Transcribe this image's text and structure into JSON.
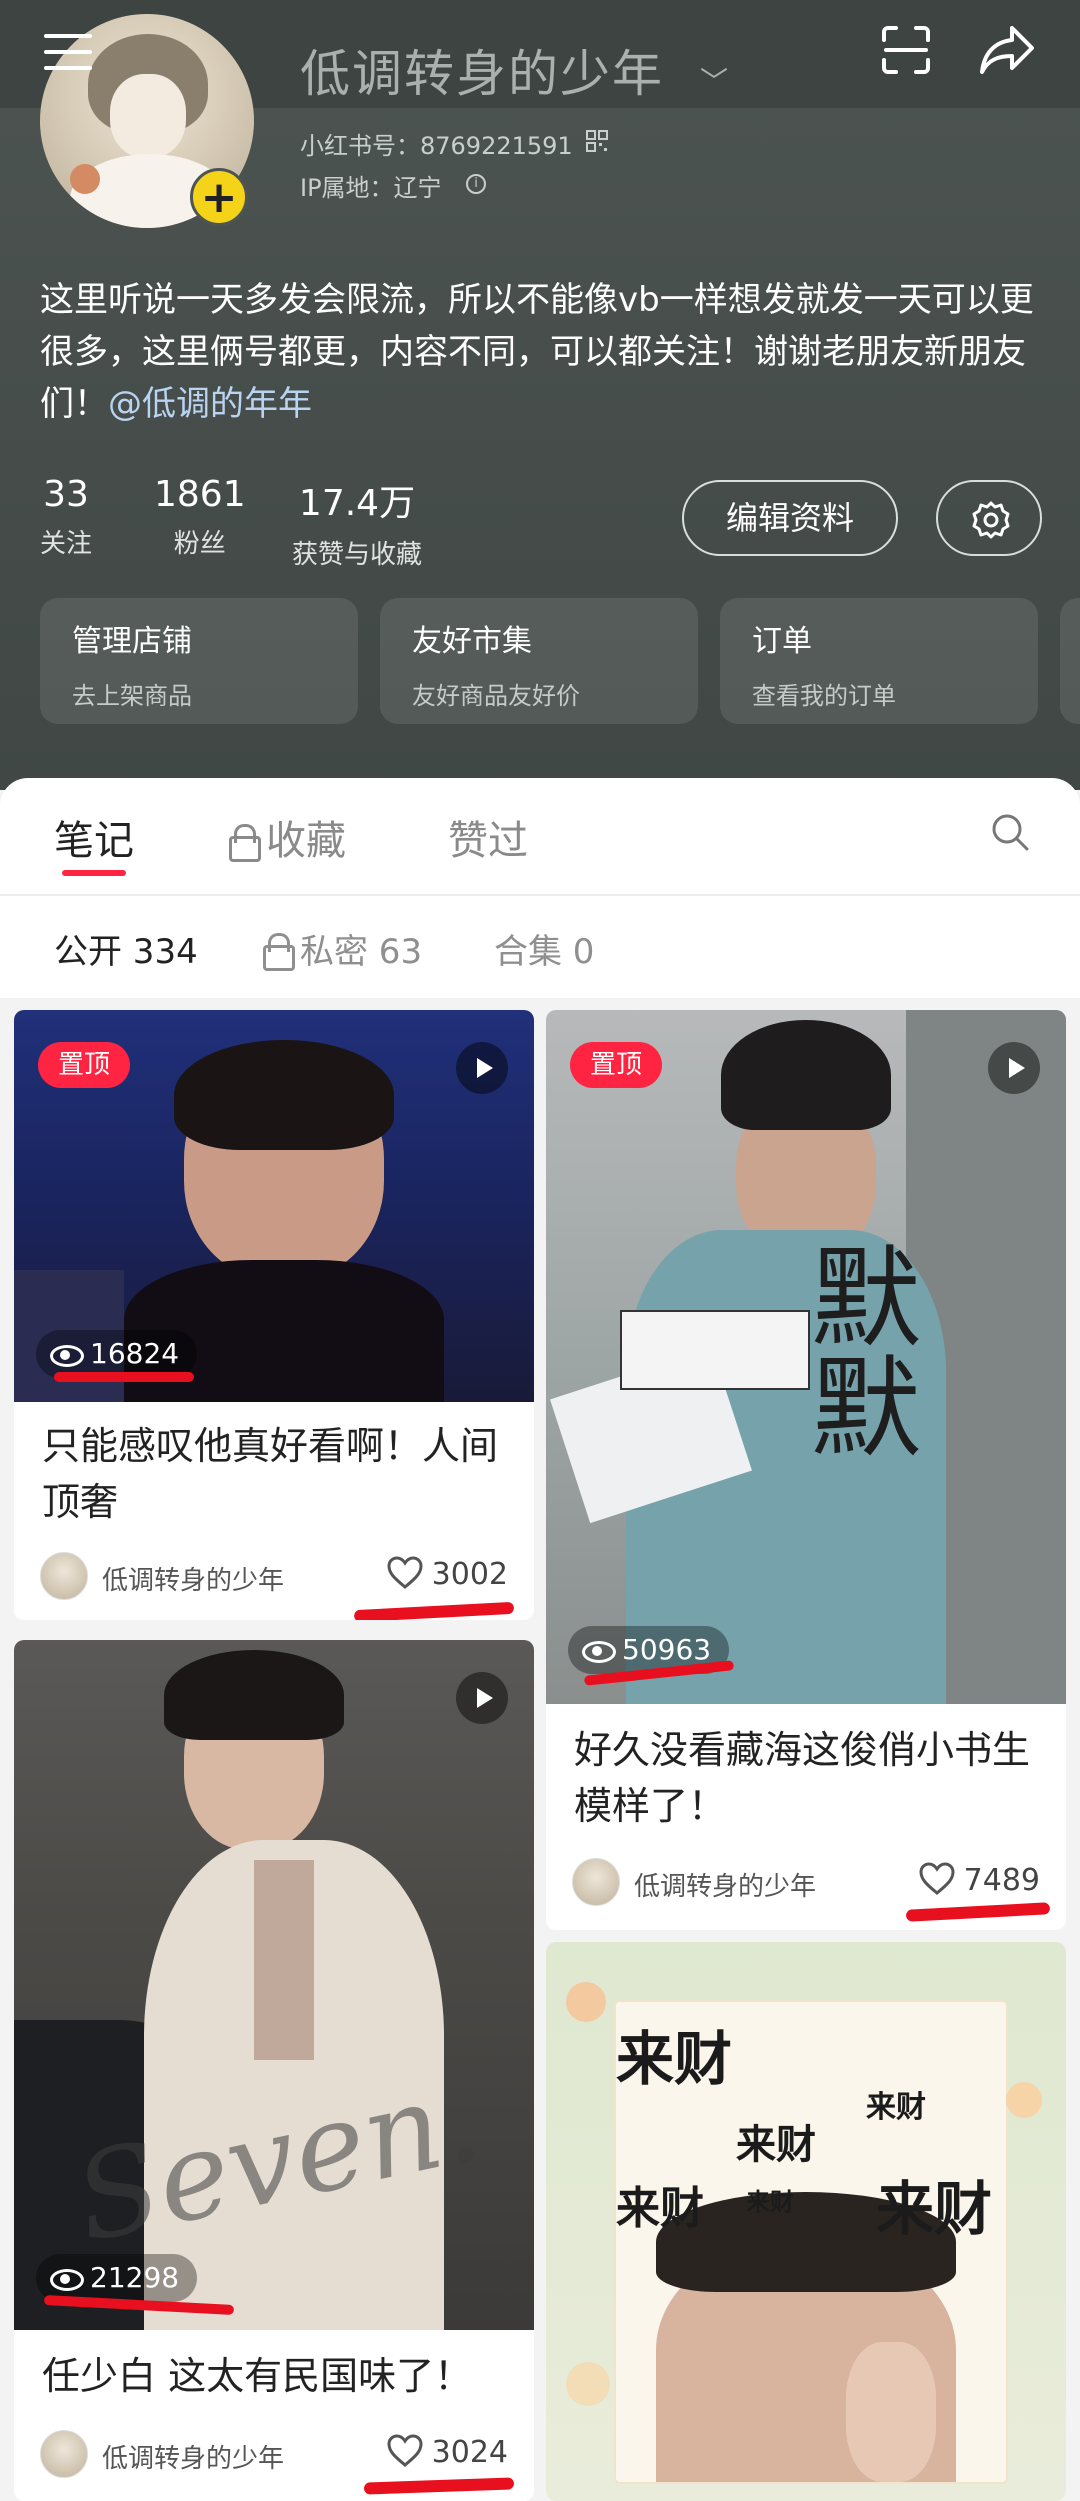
{
  "profile": {
    "nickname": "低调转身的少年",
    "red_id": "小红书号：8769221591",
    "ip": "IP属地：辽宁",
    "bio": "这里听说一天多发会限流，所以不能像vb一样想发就发一天可以更很多，这里俩号都更，内容不同，可以都关注！谢谢老朋友新朋友们！",
    "bio_mention": "@低调的年年",
    "stats": {
      "following": {
        "value": "33",
        "label": "关注"
      },
      "fans": {
        "value": "1861",
        "label": "粉丝"
      },
      "likes": {
        "value": "17.4万",
        "label": "获赞与收藏"
      }
    },
    "edit_label": "编辑资料"
  },
  "shortcuts": [
    {
      "title": "管理店铺",
      "subtitle": "去上架商品"
    },
    {
      "title": "友好市集",
      "subtitle": "友好商品友好价"
    },
    {
      "title": "订单",
      "subtitle": "查看我的订单"
    }
  ],
  "tabs": {
    "notes": "笔记",
    "collect": "收藏",
    "liked": "赞过"
  },
  "subtabs": {
    "public": "公开 334",
    "private": "私密 63",
    "collection": "合集 0"
  },
  "notes": [
    {
      "pinned": "置顶",
      "views": "16824",
      "title": "只能感叹他真好看啊！人间顶奢",
      "author": "低调转身的少年",
      "likes": "3002"
    },
    {
      "pinned": "置顶",
      "views": "50963",
      "title": "好久没看藏海这俊俏小书生模样了！",
      "author": "低调转身的少年",
      "likes": "7489",
      "cover_text": "默默"
    },
    {
      "views": "21298",
      "title": "任少白 这太有民国味了！",
      "author": "低调转身的少年",
      "likes": "3024",
      "cover_text": "Seven."
    },
    {
      "cover_words": [
        "来财",
        "来财",
        "来财",
        "来财",
        "来财",
        "来财"
      ]
    }
  ],
  "colors": {
    "accent": "#ff2442",
    "header_bg": "#4d5553",
    "pin_badge": "#ff2442",
    "scribble": "#e8101f"
  }
}
